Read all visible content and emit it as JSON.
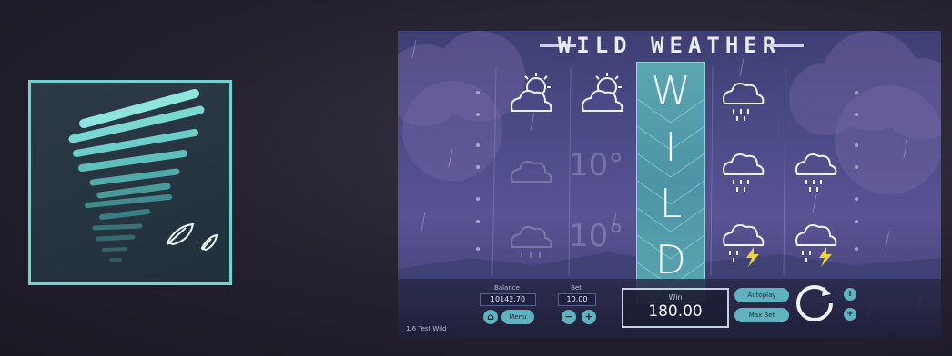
{
  "logo": {
    "icon": "tornado-leaf-icon",
    "accent": "#6fd3cf"
  },
  "game": {
    "title": "WILD WEATHER",
    "wild_letters": [
      "W",
      "I",
      "L",
      "D"
    ],
    "temperature_text": "10°",
    "symbols": [
      [
        "sun-cloud-icon",
        "cloud-thermo-faded-icon",
        "rain-cloud-faded-icon"
      ],
      [
        "sun-cloud-icon",
        "",
        ""
      ],
      [
        "wild",
        "wild",
        "wild"
      ],
      [
        "rain-cloud-icon",
        "rain-cloud-icon",
        "storm-cloud-icon"
      ],
      [
        "",
        "rain-cloud-icon",
        "storm-cloud-icon"
      ]
    ]
  },
  "panel": {
    "balance_label": "Balance",
    "balance_value": "10142.70",
    "bet_label": "Bet",
    "bet_value": "10.00",
    "menu_label": "Menu",
    "win_label": "Win",
    "win_value": "180.00",
    "autoplay_label": "Autoplay",
    "max_bet_label": "Max Bet",
    "footer": "1.6 Test Wild",
    "colors": {
      "button": "#5fb3bf",
      "panel": "#23233f"
    }
  }
}
